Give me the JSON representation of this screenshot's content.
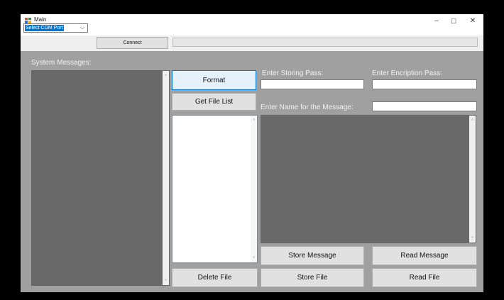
{
  "window": {
    "title": "Main",
    "controls": {
      "minimize": "–",
      "maximize": "☐",
      "close": "✕"
    }
  },
  "toolbar": {
    "com_port_select": "Select COM Port",
    "combo_arrow": "⌵",
    "connect_label": "Connect",
    "progress_fraction": 0
  },
  "labels": {
    "system_messages": "System Messages:",
    "storing_pass": "Enter Storing Pass:",
    "encryption_pass": "Enter Encription Pass:",
    "message_name": "Enter Name for the Message:"
  },
  "buttons": {
    "format": "Format",
    "get_file_list": "Get File List",
    "delete_file": "Delete File",
    "store_message": "Store Message",
    "read_message": "Read Message",
    "store_file": "Store File",
    "read_file": "Read File"
  },
  "inputs": {
    "storing_pass": "",
    "encryption_pass": "",
    "message_name": ""
  },
  "scroll_arrows": {
    "up": "˄",
    "down": "˅"
  },
  "colors": {
    "panel_bg": "#a0a0a0",
    "message_area": "#696969",
    "selection_blue": "#0078d7",
    "window_bg": "#f0f0f0"
  }
}
